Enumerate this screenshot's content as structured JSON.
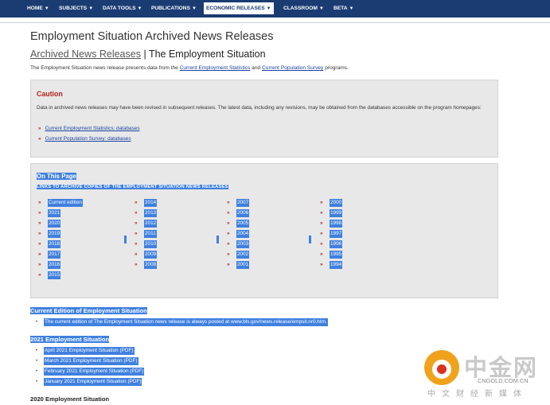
{
  "nav": {
    "items": [
      "HOME",
      "SUBJECTS",
      "DATA TOOLS",
      "PUBLICATIONS",
      "ECONOMIC RELEASES",
      "CLASSROOM",
      "BETA"
    ],
    "active_index": 4,
    "chevron_icon": "chevron-down-icon",
    "background": "#1b3b73"
  },
  "page": {
    "title": "Employment Situation Archived News Releases",
    "breadcrumb_link": "Archived News Releases",
    "breadcrumb_sep": "|",
    "breadcrumb_current": "The Employment Situation",
    "intro_before": "The Employment Situation news release presents data from the ",
    "intro_link1": "Current Employment Statistics",
    "intro_mid": " and ",
    "intro_link2": "Current Population Survey",
    "intro_after": " programs."
  },
  "caution": {
    "title": "Caution",
    "text": "Data in archived news releases may have been revised in subsequent releases. The latest data, including any revisions, may be obtained from the databases accessible on the program homepages:",
    "links": [
      "Current Employment Statistics: databases",
      "Current Population Survey: databases"
    ],
    "marker": "»"
  },
  "on_this_page": {
    "title": "On This Page",
    "subtitle": "LINKS TO ARCHIVE COPIES OF THE EMPLOYMENT SITUATION NEWS RELEASES",
    "columns": [
      [
        "Current edition",
        "2021",
        "2020",
        "2019",
        "2018",
        "2017",
        "2016",
        "2015"
      ],
      [
        "2014",
        "2013",
        "2012",
        "2011",
        "2010",
        "2009",
        "2008"
      ],
      [
        "2007",
        "2006",
        "2005",
        "2004",
        "2003",
        "2002",
        "2001"
      ],
      [
        "2000",
        "1999",
        "1998",
        "1997",
        "1996",
        "1995",
        "1994"
      ]
    ],
    "marker": "»"
  },
  "current_edition": {
    "heading": "Current Edition of Employment Situation",
    "text": "The current edition of The Employment Situation news release is always posted at www.bls.gov/news.release/empsit.nr0.htm."
  },
  "y2021": {
    "heading": "2021 Employment Situation",
    "items": [
      "April 2021 Employment Situation (PDF)",
      "March 2021 Employment Situation (PDF)",
      "February 2021 Employment Situation (PDF)",
      "January 2021 Employment Situation (PDF)"
    ]
  },
  "y2020": {
    "heading": "2020 Employment Situation"
  },
  "watermark": {
    "brand": "中金网",
    "domain": "CNGOLD.COM.CN",
    "slogan": "中文财经新媒体",
    "logo_icon": "coin-logo-icon"
  },
  "colors": {
    "selection": "#3f80e0",
    "marker": "#b5211f",
    "link": "#1a44a0",
    "panel": "#e8e8e8"
  }
}
